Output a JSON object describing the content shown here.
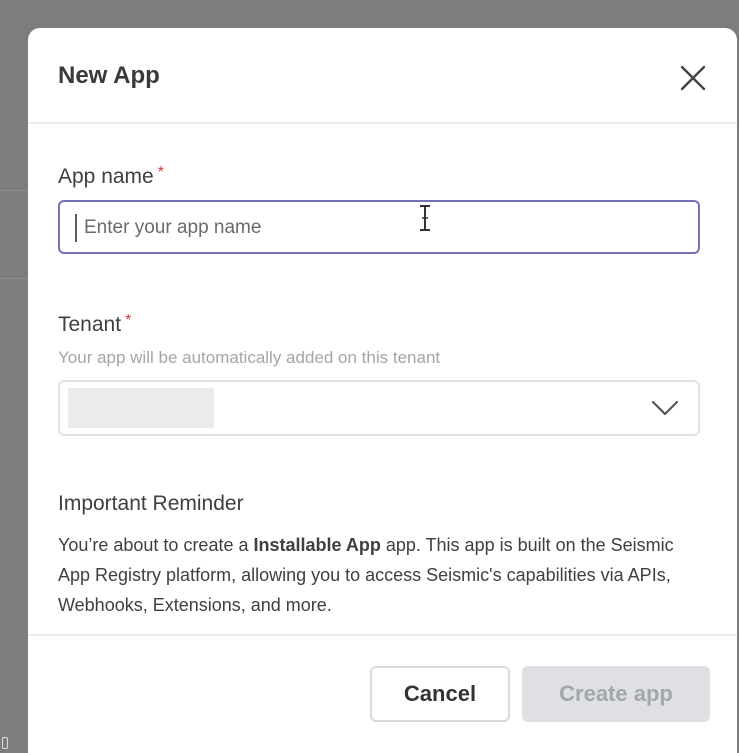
{
  "modal": {
    "title": "New App",
    "close_icon": "close-icon"
  },
  "app_name": {
    "label": "App name",
    "required_mark": "*",
    "placeholder": "Enter your app name",
    "value": ""
  },
  "tenant": {
    "label": "Tenant",
    "required_mark": "*",
    "helper": "Your app will be automatically added on this tenant",
    "selected_value_redacted": true,
    "dropdown_icon": "chevron-down-icon"
  },
  "reminder": {
    "title": "Important Reminder",
    "body_before": "You’re about to create a ",
    "body_bold": "Installable App",
    "body_after": " app. This app is built on the Seismic App Registry platform, allowing you to access Seismic's capabilities via APIs, Webhooks, Extensions, and more."
  },
  "footer": {
    "cancel_label": "Cancel",
    "create_label": "Create app",
    "create_disabled": true
  },
  "colors": {
    "accent_focus": "#7370b5",
    "required": "#d13b3b",
    "disabled_button_bg": "#dfe0e3"
  }
}
